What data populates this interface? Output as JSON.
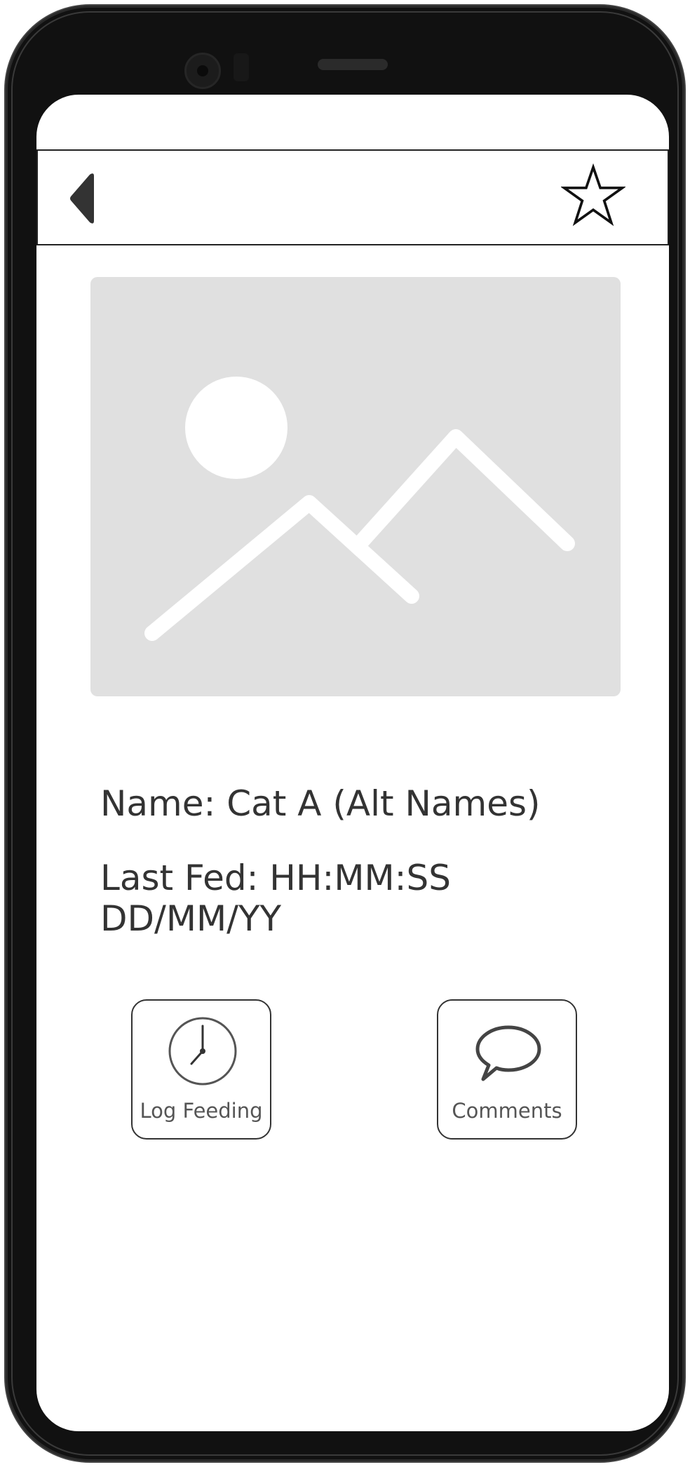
{
  "screen": {
    "name_label": "Name: Cat A (Alt Names)",
    "last_fed_line1": "Last Fed: HH:MM:SS",
    "last_fed_line2": "DD/MM/YY"
  },
  "actions": {
    "log_feeding_label": "Log Feeding",
    "comments_label": "Comments"
  },
  "icons": {
    "back": "back-triangle-icon",
    "favorite": "star-icon",
    "placeholder": "image-placeholder-icon",
    "clock": "clock-icon",
    "speech": "speech-bubble-icon"
  },
  "colors": {
    "placeholder_bg": "#e0e0e0",
    "text": "#333333",
    "frame": "#111111"
  }
}
